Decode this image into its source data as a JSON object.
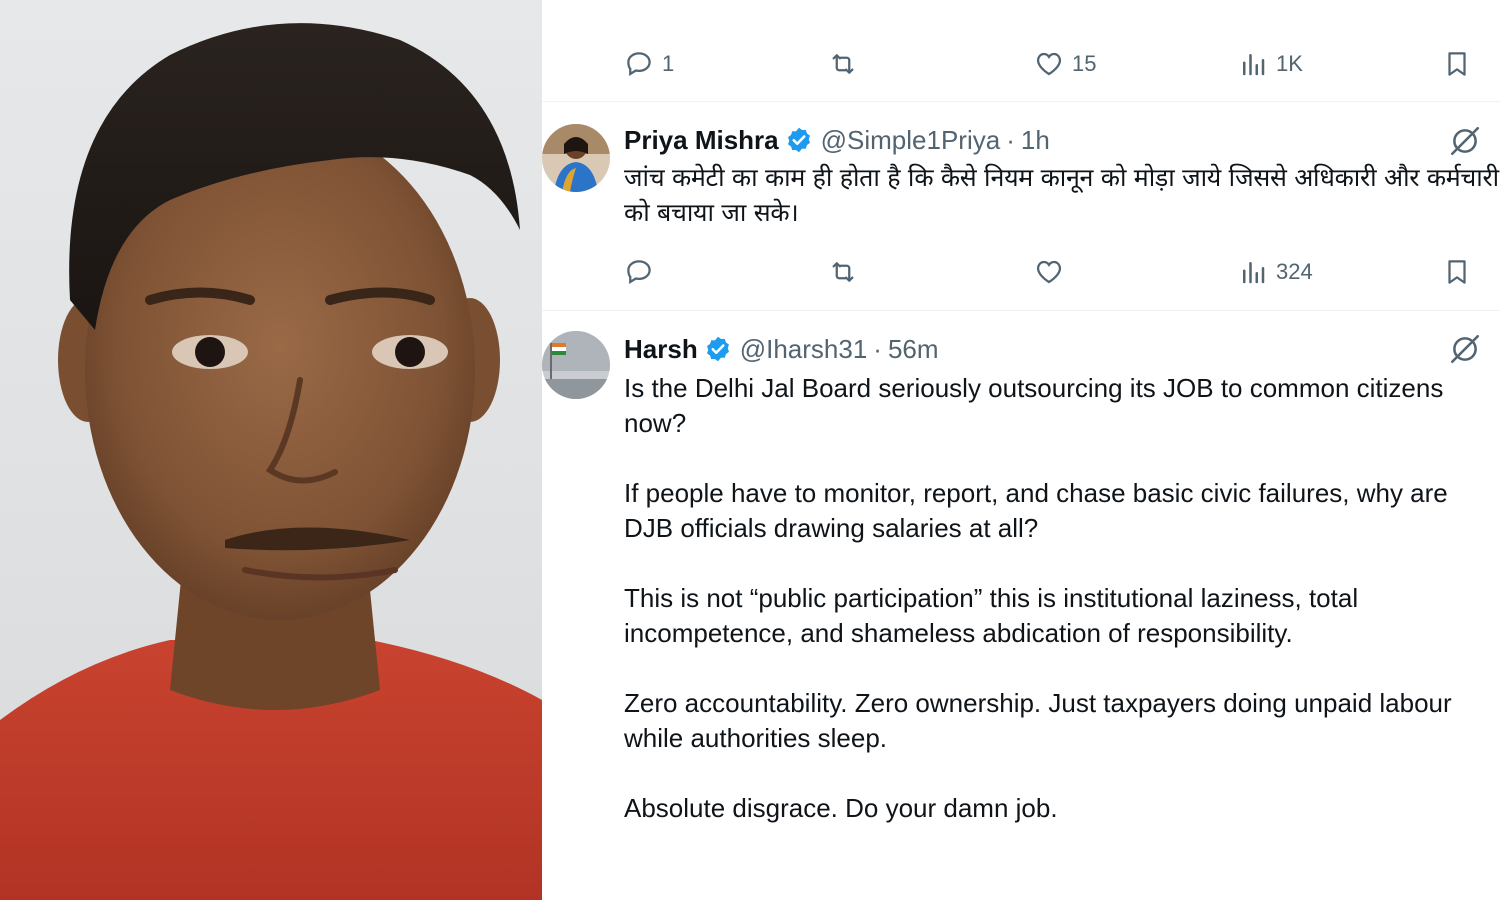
{
  "colors": {
    "text_primary": "#0f1419",
    "text_secondary": "#536471",
    "verified_blue": "#1d9bf0",
    "divider": "#eff3f4",
    "shirt_red": "#c23b2a"
  },
  "photo": {
    "description_icon": "portrait-photo"
  },
  "top_actions": {
    "reply_count": "1",
    "retweet_count": "",
    "like_count": "15",
    "views_count": "1K"
  },
  "tweets": [
    {
      "display_name": "Priya Mishra",
      "handle": "@Simple1Priya",
      "separator": "·",
      "time": "1h",
      "text": "जांच कमेटी का काम ही होता है कि कैसे नियम कानून को मोड़ा जाये जिससे अधिकारी और कर्मचारी को बचाया जा सके।",
      "actions": {
        "reply_count": "",
        "retweet_count": "",
        "like_count": "",
        "views_count": "324"
      }
    },
    {
      "display_name": "Harsh",
      "handle": "@Iharsh31",
      "separator": "·",
      "time": "56m",
      "paragraphs": [
        "Is the Delhi Jal Board seriously outsourcing its JOB to common citizens now?",
        "If people have to monitor, report, and chase basic civic failures, why are DJB officials drawing salaries at all?",
        "This is not “public participation” this is institutional laziness, total incompetence, and shameless abdication of responsibility.",
        "Zero accountability. Zero ownership. Just taxpayers doing unpaid labour while authorities sleep.",
        "Absolute disgrace. Do your damn job."
      ]
    }
  ],
  "icons": {
    "reply": "reply-icon",
    "retweet": "retweet-icon",
    "like": "heart-icon",
    "views": "views-icon",
    "bookmark": "bookmark-icon",
    "verified": "verified-badge-icon",
    "grok": "grok-icon"
  }
}
